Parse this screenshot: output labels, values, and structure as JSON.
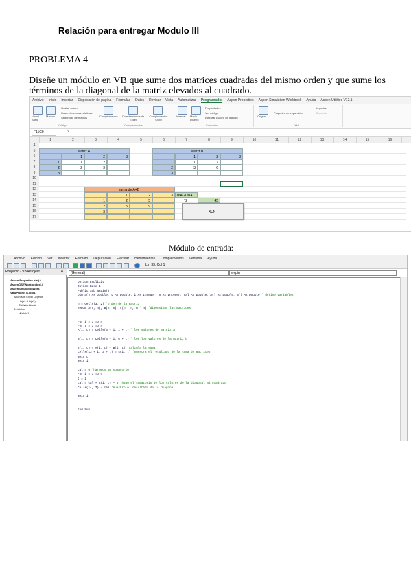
{
  "document": {
    "title": "Relación para entregar Modulo III",
    "problem": "PROBLEMA 4",
    "statement": "Diseñe un módulo en VB que sume dos matrices cuadradas del mismo orden y que sume los términos de la diagonal de la matriz elevados al cuadrado.",
    "module_caption": "Módulo de entrada:"
  },
  "excel": {
    "tabs": [
      "Archivo",
      "Inicio",
      "Insertar",
      "Disposición de página",
      "Fórmulas",
      "Datos",
      "Revisar",
      "Vista",
      "Automatizar",
      "Programador",
      "Aspen Properties",
      "Aspen Simulation Workbook",
      "Ayuda",
      "Aspen Utilities V12.1"
    ],
    "active_tab": "Programador",
    "ribbon": {
      "visual_basic": "Visual Basic",
      "macros": "Macros",
      "grabar_macro": "Grabar macro",
      "usar_ref": "Usar referencias relativas",
      "seguridad": "Seguridad de macros",
      "codigo": "Código",
      "complementos": "Complementos",
      "complementos_excel": "Complementos de Excel",
      "complementos_com": "Complementos COM",
      "grp_complementos": "Complementos",
      "insertar": "Insertar",
      "modo_diseno": "Modo Diseño",
      "propiedades": "Propiedades",
      "ver_codigo": "Ver código",
      "ejecutar_cuadro": "Ejecutar cuadro de diálogo",
      "controles": "Controles",
      "origen": "Origen",
      "paquetes": "Paquetes de expansión",
      "importar": "Importar",
      "exportar": "Exportar",
      "xml": "XML"
    },
    "name_box": "F11C9",
    "fx": "fx",
    "columns": [
      "1",
      "2",
      "3",
      "4",
      "5",
      "6",
      "7",
      "8",
      "9",
      "10",
      "11",
      "12",
      "13",
      "14",
      "15",
      "16"
    ],
    "rows": [
      "4",
      "5",
      "6",
      "7",
      "8",
      "9",
      "10",
      "11",
      "12",
      "13",
      "14",
      "15",
      "16",
      "17"
    ],
    "matriz_a": {
      "label": "Matriz A",
      "values": [
        [
          "",
          "1",
          "2",
          "3"
        ],
        [
          "1",
          "1",
          "2",
          ""
        ],
        [
          "2",
          "2",
          "3",
          ""
        ],
        [
          "3",
          "",
          "",
          ""
        ]
      ]
    },
    "matriz_b": {
      "label": "Matriz B",
      "values": [
        [
          "",
          "1",
          "2",
          "3"
        ],
        [
          "1",
          "1",
          "7",
          ""
        ],
        [
          "2",
          "3",
          "6",
          ""
        ],
        [
          "3",
          "",
          "",
          ""
        ]
      ]
    },
    "suma": {
      "label": "suma de A+B",
      "header": [
        "",
        "1",
        "2",
        "3"
      ],
      "values": [
        [
          "1",
          "2",
          "5"
        ],
        [
          "2",
          "5",
          "9"
        ],
        [
          "3",
          "",
          ""
        ]
      ]
    },
    "diagonal": {
      "label": "DIAGONAL ^2",
      "value": "45"
    },
    "run_button": "RUN"
  },
  "vba": {
    "menu": [
      "Archivo",
      "Edición",
      "Ver",
      "Insertar",
      "Formato",
      "Depuración",
      "Ejecutar",
      "Herramientas",
      "Complementos",
      "Ventana",
      "Ayuda"
    ],
    "position": "Lín 33, Col 1",
    "project_title": "Proyecto - VBAProject",
    "tree": [
      "Aspen Properties.xla (A",
      "AspenOSEWorkbook.xl.#",
      "AspenSimulationWork",
      "VBAProject (Libro1)",
      "Microsoft Excel Objetos",
      "Hoja1 (Hoja1)",
      "ThisWorkbook",
      "Módulos",
      "Módulo1"
    ],
    "combo_left": "(General)",
    "combo_right": "wxpin",
    "code": [
      "Option Explicit",
      "Option Base 1",
      "Public Sub wxpin()",
      "Dim a() As Double, t As Double, i As Integer, n As Integer, cal As Double, A() As Double, B() As Double ' define variables",
      "",
      "n = Cells(3, 2) 'orden de la matriz",
      "ReDim A(n, n), B(n, n), s(n * n, n * n) 'dimensionr las matrices",
      "",
      "",
      "For i = 1 To n",
      "For t = 1 To n",
      "A(i, t) = Cells(6 + i, 1 + t) ' lee valores de matriz a",
      "",
      "B(i, t) = Cells(6 + i, 6 + t) ' lee los valores de la matriz b",
      "",
      "s(i, t) = A(i, t) + B(i, t) 'calcula la suma",
      "Cells(13 + i, 3 + t) = s(i, t) 'muestra el resultado de la suma de matrices",
      "Next t",
      "Next i",
      "",
      "cal = 0 'haremos un sumatorio",
      "For i = 1 To n",
      "t = i",
      "cal = cal + s(i, t) ^ 2 'hago el sumatorio de los valores de la diagonal al cuadrado",
      "Cells(14, 7) = cal 'muestro el resultado de la diagonal",
      "",
      "Next i",
      "",
      "",
      "End Sub"
    ]
  }
}
